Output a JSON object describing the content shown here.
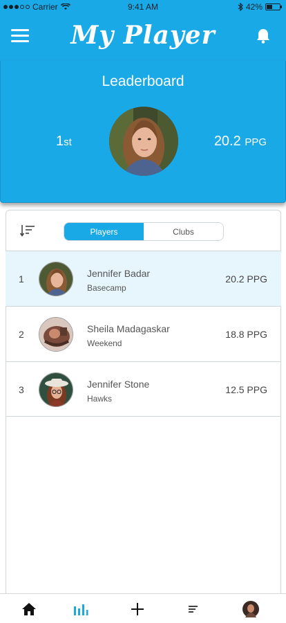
{
  "status_bar": {
    "carrier": "Carrier",
    "time": "9:41 AM",
    "battery": "42%",
    "battery_level": 0.42
  },
  "header": {
    "title": "My Player"
  },
  "hero": {
    "title": "Leaderboard",
    "rank_number": "1",
    "rank_suffix": "st",
    "ppg_value": "20.2",
    "ppg_unit": "PPG"
  },
  "tabs": {
    "players": "Players",
    "clubs": "Clubs",
    "active": "Players"
  },
  "leaderboard": [
    {
      "rank": "1",
      "name": "Jennifer Badar",
      "team": "Basecamp",
      "ppg": "20.2 PPG"
    },
    {
      "rank": "2",
      "name": "Sheila Madagaskar",
      "team": "Weekend",
      "ppg": "18.8 PPG"
    },
    {
      "rank": "3",
      "name": "Jennifer Stone",
      "team": "Hawks",
      "ppg": "12.5 PPG"
    }
  ],
  "nav": {
    "active": "stats",
    "items": [
      "home-icon",
      "stats-icon",
      "plus-icon",
      "list-icon",
      "profile-avatar"
    ]
  },
  "colors": {
    "accent": "#1aa9e7",
    "highlight_row": "#e7f5fc"
  }
}
